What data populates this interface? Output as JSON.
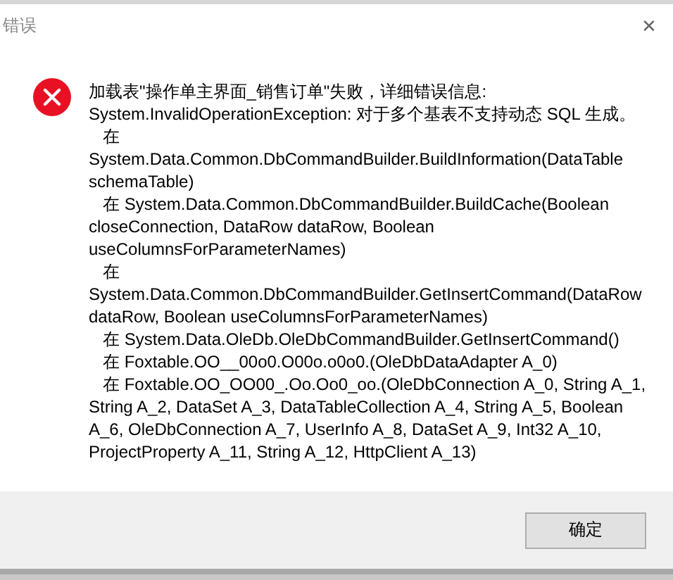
{
  "window": {
    "title": "错误",
    "close": "✕"
  },
  "message": {
    "lines": [
      "加载表\"操作单主界面_销售订单\"失败，详细错误信息:",
      "System.InvalidOperationException: 对于多个基表不支持动态 SQL 生成。",
      "   在 System.Data.Common.DbCommandBuilder.BuildInformation(DataTable schemaTable)",
      "   在 System.Data.Common.DbCommandBuilder.BuildCache(Boolean closeConnection, DataRow dataRow, Boolean useColumnsForParameterNames)",
      "   在 System.Data.Common.DbCommandBuilder.GetInsertCommand(DataRow dataRow, Boolean useColumnsForParameterNames)",
      "   在 System.Data.OleDb.OleDbCommandBuilder.GetInsertCommand()",
      "   在 Foxtable.OO__00o0.O00o.o0o0.(OleDbDataAdapter A_0)",
      "   在 Foxtable.OO_OO00_.Oo.Oo0_oo.(OleDbConnection A_0, String A_1, String A_2, DataSet A_3, DataTableCollection A_4, String A_5, Boolean A_6, OleDbConnection A_7, UserInfo A_8, DataSet A_9, Int32 A_10, ProjectProperty A_11, String A_12, HttpClient A_13)"
    ]
  },
  "buttons": [
    {
      "label": "确定"
    }
  ]
}
